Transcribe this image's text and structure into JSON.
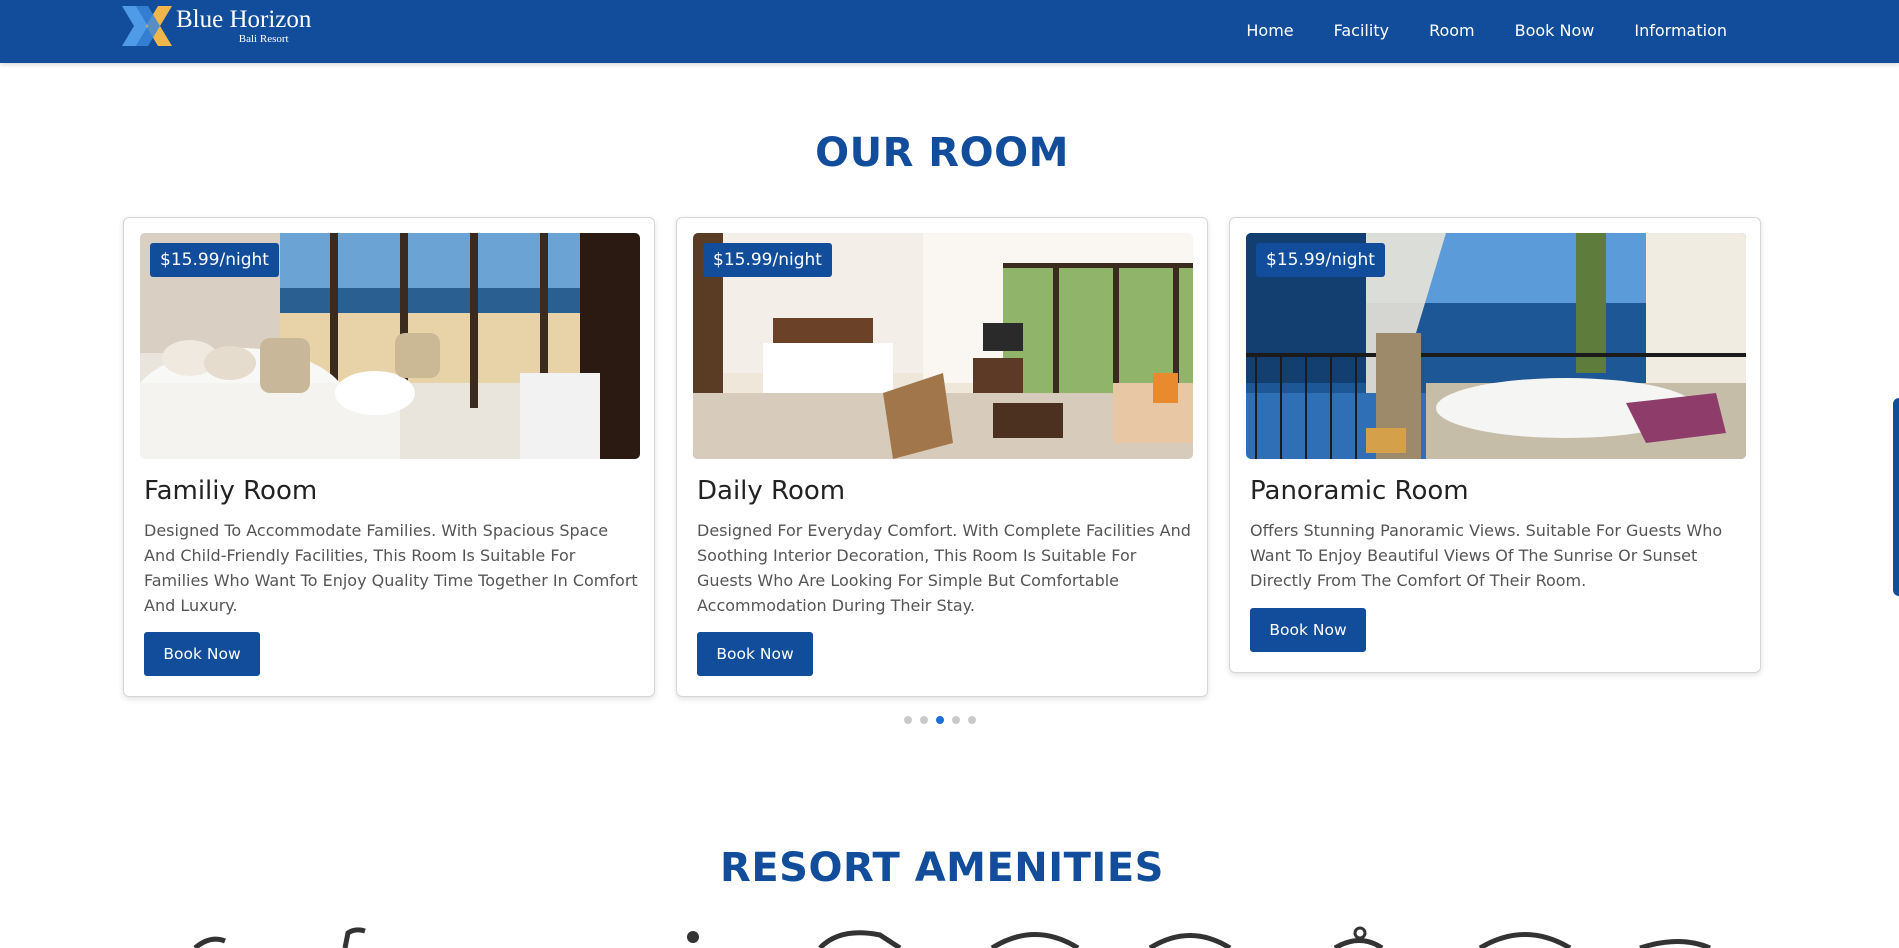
{
  "brand": {
    "name": "Blue Horizon",
    "subtitle": "Bali Resort"
  },
  "nav": [
    "Home",
    "Facility",
    "Room",
    "Book Now",
    "Information"
  ],
  "rooms_section": {
    "title": "OUR ROOM",
    "rooms": [
      {
        "price": "$15.99/night",
        "name": "Familiy Room",
        "description": "Designed To Accommodate Families. With Spacious Space And Child-Friendly Facilities, This Room Is Suitable For Families Who Want To Enjoy Quality Time Together In Comfort And Luxury.",
        "button": "Book Now"
      },
      {
        "price": "$15.99/night",
        "name": "Daily Room",
        "description": "Designed For Everyday Comfort. With Complete Facilities And Soothing Interior Decoration, This Room Is Suitable For Guests Who Are Looking For Simple But Comfortable Accommodation During Their Stay.",
        "button": "Book Now"
      },
      {
        "price": "$15.99/night",
        "name": "Panoramic Room",
        "description": "Offers Stunning Panoramic Views. Suitable For Guests Who Want To Enjoy Beautiful Views Of The Sunrise Or Sunset Directly From The Comfort Of Their Room.",
        "button": "Book Now"
      }
    ],
    "carousel": {
      "total_pages": 5,
      "active_page": 3
    }
  },
  "amenities_section": {
    "title": "RESORT AMENITIES"
  },
  "colors": {
    "primary": "#124d9c",
    "accent_dot": "#1d6fd8",
    "logo_blue": "#4f9be8",
    "logo_gold": "#f0b64a"
  },
  "icons": [
    "logo-mark-icon",
    "room-photo-ocean-view",
    "room-photo-daily",
    "room-photo-balcony",
    "amenity-icons"
  ]
}
